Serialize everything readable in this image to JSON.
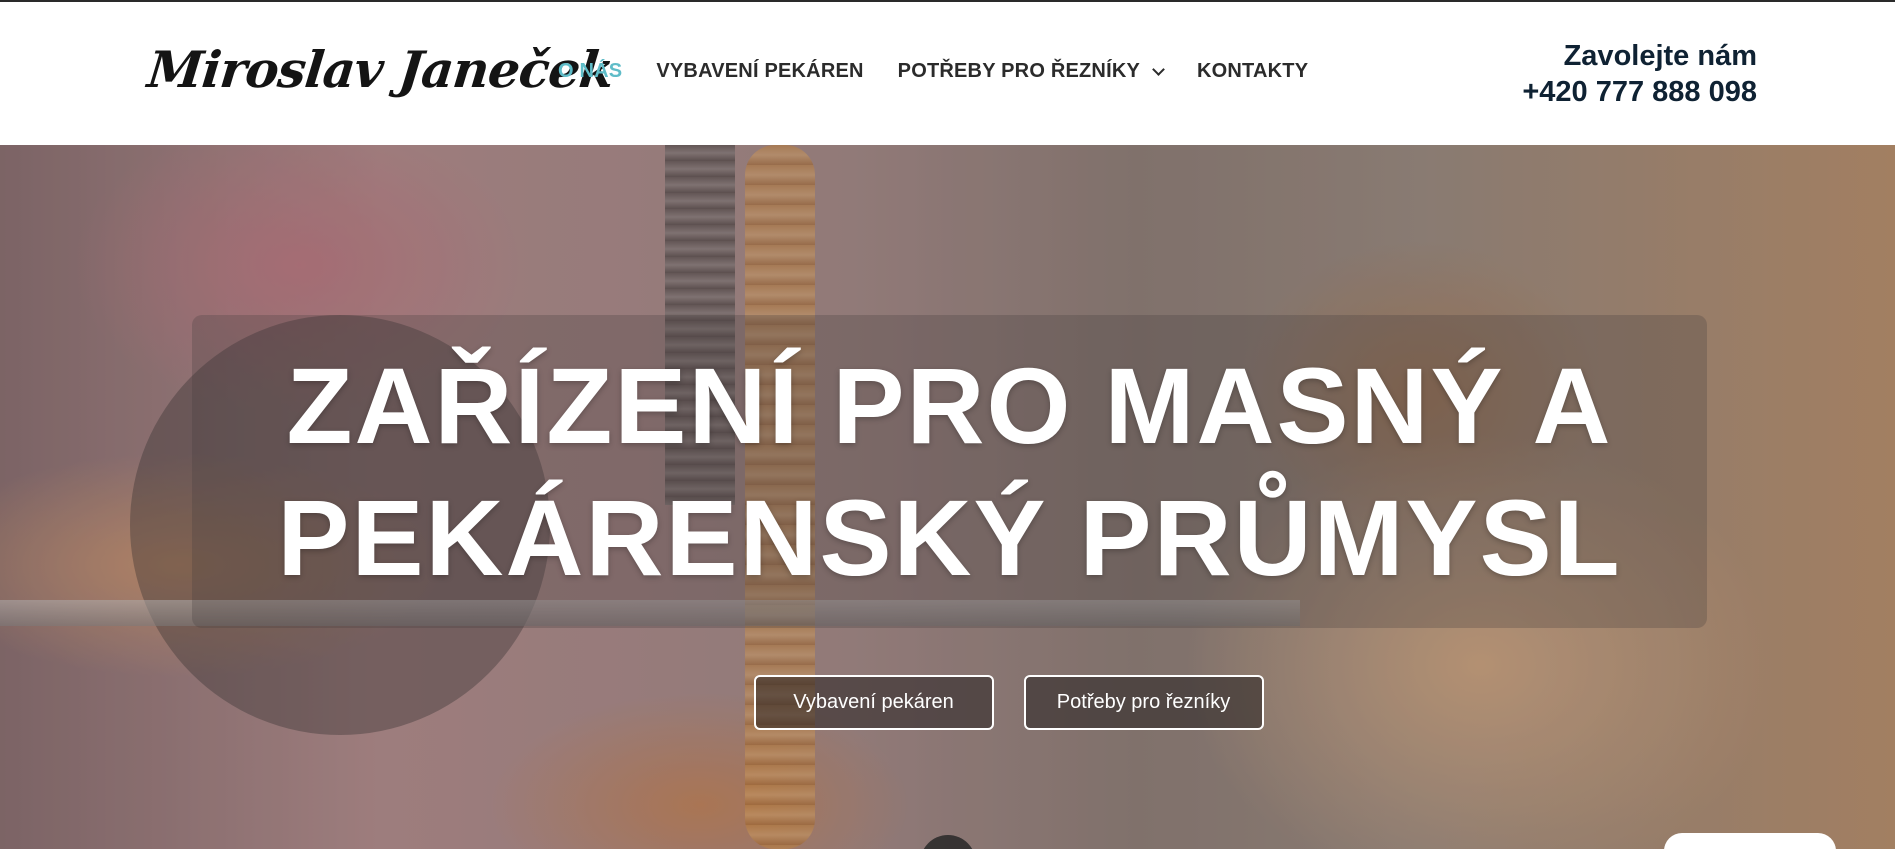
{
  "header": {
    "logo_text": "Miroslav Janeček",
    "nav": [
      {
        "label": "O NÁS",
        "active": true
      },
      {
        "label": "VYBAVENÍ PEKÁREN",
        "active": false
      },
      {
        "label": "POTŘEBY PRO ŘEZNÍKY",
        "active": false,
        "has_dropdown": true
      },
      {
        "label": "KONTAKTY",
        "active": false
      }
    ],
    "phone_label": "Zavolejte nám",
    "phone_number": "+420 777 888 098"
  },
  "hero": {
    "title_line1": "ZAŘÍZENÍ PRO MASNÝ A",
    "title_line2": "PEKÁRENSKÝ PRŮMYSL",
    "buttons": [
      {
        "label": "Vybavení pekáren"
      },
      {
        "label": "Potřeby pro řezníky"
      }
    ]
  },
  "colors": {
    "accent": "#5fbcc8",
    "nav_text": "#2b2b2b",
    "phone_text": "#0f2233",
    "hero_text": "#ffffff"
  },
  "icons": {
    "dropdown": "chevron-down-icon"
  }
}
